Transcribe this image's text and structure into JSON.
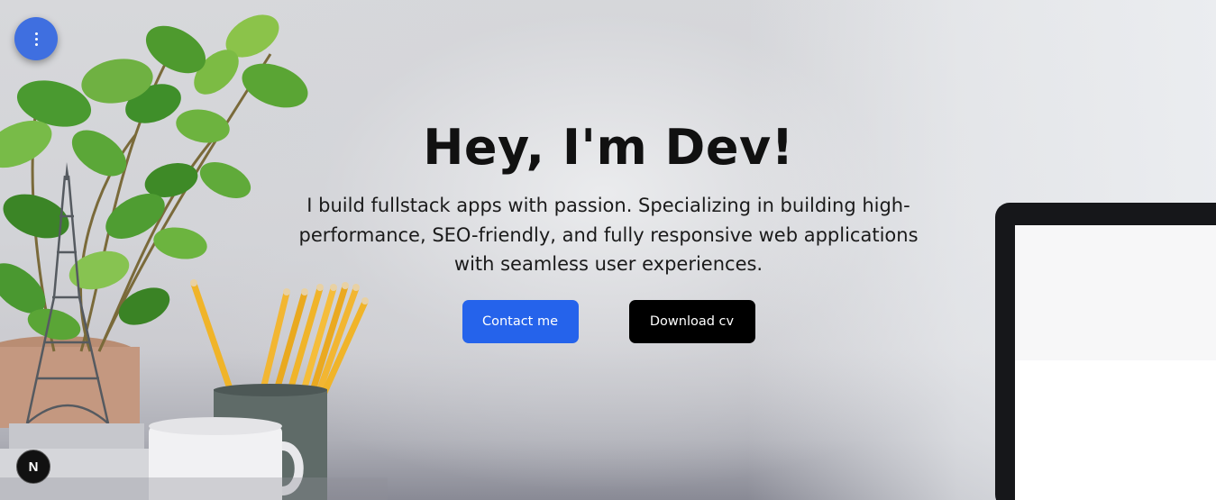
{
  "hero": {
    "title": "Hey, I'm Dev!",
    "subtitle": "I build fullstack apps with passion. Specializing in building high-performance, SEO-friendly, and fully responsive web applications with seamless user experiences.",
    "contact_label": "Contact me",
    "download_label": "Download cv"
  },
  "nav": {
    "menu_icon": "vertical-dots-icon"
  },
  "badge": {
    "letter": "N"
  },
  "colors": {
    "primary": "#2563eb",
    "dark": "#000000",
    "fab": "#3f6fe0",
    "text": "#111111"
  }
}
